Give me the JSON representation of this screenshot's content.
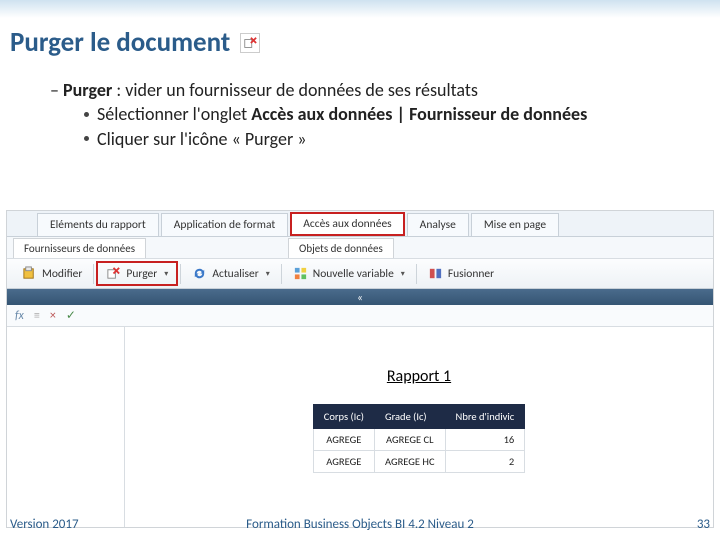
{
  "slide": {
    "title": "Purger le document",
    "line1_prefix": "– ",
    "line1_bold": "Purger",
    "line1_rest": " : vider un fournisseur de données de ses résultats",
    "sub1_a": "Sélectionner l'onglet ",
    "sub1_b": "Accès aux données | Fournisseur de données",
    "sub2": "Cliquer sur l'icône « Purger »"
  },
  "tabs": {
    "t1": "Eléments du rapport",
    "t2": "Application de format",
    "t3": "Accès aux données",
    "t4": "Analyse",
    "t5": "Mise en page"
  },
  "subtabs": {
    "s1": "Fournisseurs de données",
    "s2": "Objets de données"
  },
  "toolbar": {
    "modifier": "Modifier",
    "purger": "Purger",
    "actualiser": "Actualiser",
    "nouvelle_var": "Nouvelle variable",
    "fusionner": "Fusionner"
  },
  "fx": {
    "label": "fx",
    "x": "×",
    "check": "✓"
  },
  "report": {
    "title": "Rapport 1",
    "headers": {
      "c1": "Corps (Ic)",
      "c2": "Grade (Ic)",
      "c3": "Nbre d'indivic"
    },
    "rows": [
      {
        "c1": "AGREGE",
        "c2": "AGREGE CL",
        "c3": "16"
      },
      {
        "c1": "AGREGE",
        "c2": "AGREGE HC",
        "c3": "2"
      }
    ]
  },
  "footer": {
    "version": "Version 2017",
    "center": "Formation Business Objects BI 4.2 Niveau 2",
    "page": "33"
  }
}
